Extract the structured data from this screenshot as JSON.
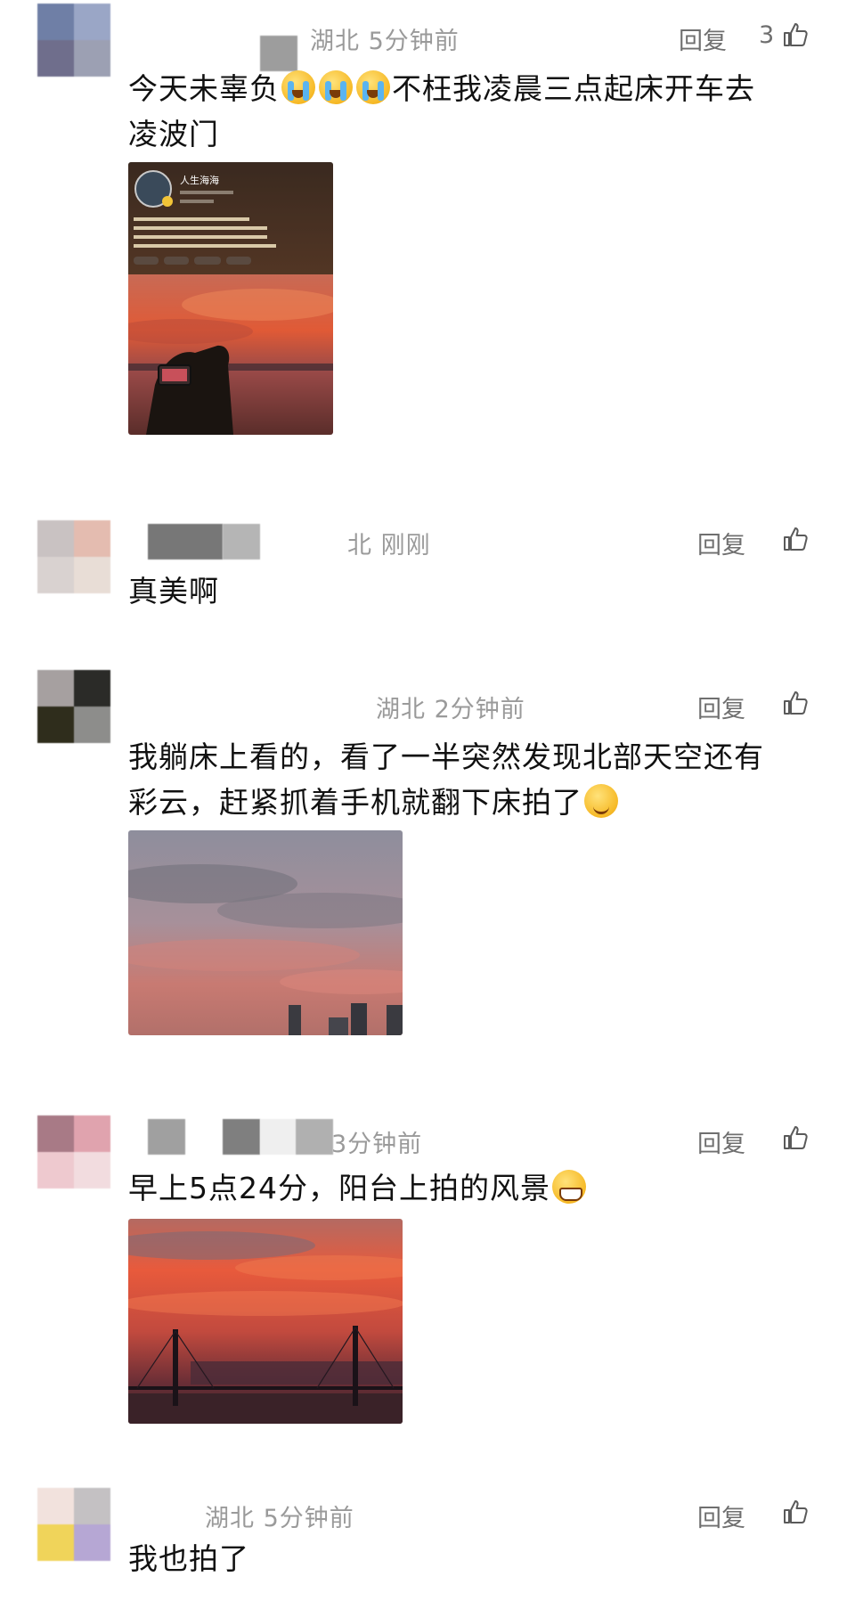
{
  "ui": {
    "reply_label": "回复"
  },
  "comments": [
    {
      "location_time": "湖北 5分钟前",
      "like_count": "3",
      "text_parts": [
        "今天未辜负",
        "不枉我凌晨三点起床开车去",
        "凌波门"
      ],
      "avatar_colors": [
        "#6f7fa6",
        "#9aa6c6",
        "#6f6e8c",
        "#9ca0b3"
      ],
      "image": {
        "kind": "profile-screenshot",
        "profile_name": "人生海海"
      }
    },
    {
      "location_time": "北 刚刚",
      "like_count": "",
      "text": "真美啊",
      "avatar_colors": [
        "#c9c2c2",
        "#e4bcb0",
        "#d9d2d0",
        "#e8ddd6"
      ]
    },
    {
      "location_time": "湖北 2分钟前",
      "like_count": "",
      "text_parts": [
        "我躺床上看的，看了一半突然发现北部天空还有",
        "彩云，赶紧抓着手机就翻下床拍了"
      ],
      "avatar_colors": [
        "#a6a0a0",
        "#2b2b28",
        "#2f2d1c",
        "#8d8d8b"
      ],
      "image": {
        "kind": "sky-photo"
      }
    },
    {
      "location_time": "3分钟前",
      "like_count": "",
      "text_parts": [
        "早上5点24分，阳台上拍的风景"
      ],
      "avatar_colors": [
        "#a87a86",
        "#e0a3ae",
        "#eec9cf",
        "#f2dcdf"
      ],
      "image": {
        "kind": "bridge-photo"
      }
    },
    {
      "location_time": "湖北 5分钟前",
      "like_count": "",
      "text": "我也拍了",
      "avatar_colors": [
        "#f2e2dd",
        "#c4c1c3",
        "#f0d45a",
        "#b6a7d4"
      ]
    }
  ]
}
